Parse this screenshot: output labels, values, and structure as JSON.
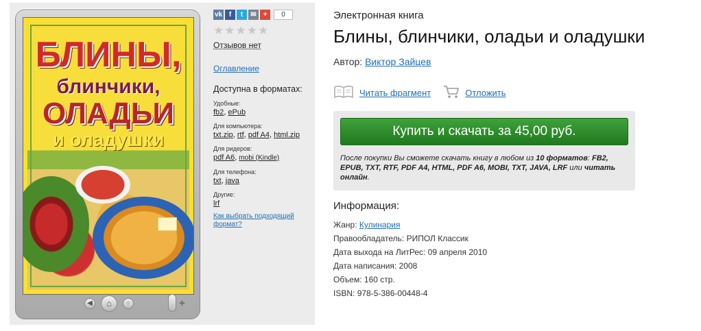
{
  "social": {
    "vk": "vk",
    "fb": "f",
    "tw": "t",
    "mail": "✉",
    "gplus": "+",
    "count": "0"
  },
  "rating": {
    "stars_filled": 0,
    "stars_total": 5,
    "reviews": "Отзывов нет"
  },
  "sidebar": {
    "toc": "Оглавление",
    "formats_title": "Доступна в форматах:",
    "groups": [
      {
        "label": "Удобные:",
        "links": [
          "fb2",
          "ePub"
        ]
      },
      {
        "label": "Для компьютера:",
        "links": [
          "txt.zip",
          "rtf",
          "pdf A4",
          "html.zip"
        ]
      },
      {
        "label": "Для ридеров:",
        "links": [
          "pdf A6",
          "mobi (Kindle)"
        ]
      },
      {
        "label": "Для телефона:",
        "links": [
          "txt",
          "java"
        ]
      },
      {
        "label": "Другие:",
        "links": [
          "lrf"
        ]
      }
    ],
    "choose_link": "Как выбрать подходящий формат?"
  },
  "cover": {
    "line1": "БЛИНЫ,",
    "line2": "блинчики,",
    "line3": "ОЛАДЬИ",
    "line4": "и оладушки"
  },
  "book": {
    "kind": "Электронная книга",
    "title": "Блины, блинчики, оладьи и оладушки",
    "author_label": "Автор:",
    "author": "Виктор Зайцев"
  },
  "actions": {
    "read": "Читать фрагмент",
    "defer": "Отложить"
  },
  "buy": {
    "button": "Купить и скачать за 45,00 руб.",
    "note_start": "После покупки Вы сможете скачать книгу в любом из",
    "note_count": "10 форматов",
    "note_formats": "FB2, EPUB, TXT, RTF, PDF A4, HTML, PDF A6, MOBI, TXT, JAVA, LRF",
    "note_or": "или",
    "note_online": "читать онлайн"
  },
  "info": {
    "title": "Информация:",
    "genre_label": "Жанр:",
    "genre": "Кулинария",
    "rights_label": "Правообладатель:",
    "rights": "РИПОЛ Классик",
    "release_label": "Дата выхода на ЛитРес:",
    "release": "09 апреля 2010",
    "written_label": "Дата написания:",
    "written": "2008",
    "volume_label": "Объем:",
    "volume": "160 стр.",
    "isbn_label": "ISBN:",
    "isbn": "978-5-386-00448-4"
  }
}
